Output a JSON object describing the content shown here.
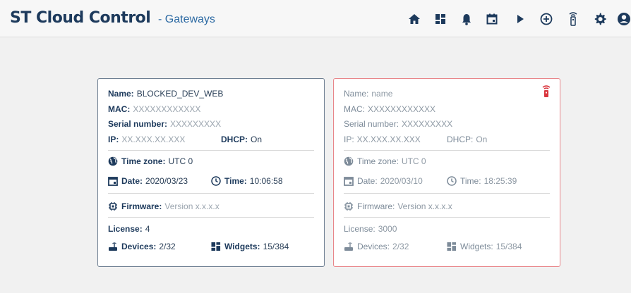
{
  "app": {
    "title": "ST Cloud Control",
    "section": "- Gateways"
  },
  "header_icons": [
    "home-icon",
    "dashboard-icon",
    "bell-icon",
    "calendar-icon",
    "play-icon",
    "add-circle-icon",
    "gateway-icon",
    "gear-icon",
    "account-icon"
  ],
  "labels": {
    "name": "Name:",
    "mac": "MAC:",
    "serial": "Serial number:",
    "ip": "IP:",
    "dhcp": "DHCP:",
    "timezone": "Time zone:",
    "date": "Date:",
    "time": "Time:",
    "firmware": "Firmware:",
    "license": "License:",
    "devices": "Devices:",
    "widgets": "Widgets:"
  },
  "cards": [
    {
      "name": "BLOCKED_DEV_WEB",
      "mac": "XXXXXXXXXXXX",
      "serial": "XXXXXXXXX",
      "ip": "XX.XXX.XX.XXX",
      "dhcp": "On",
      "timezone": "UTC 0",
      "date": "2020/03/23",
      "time": "10:06:58",
      "firmware": "Version x.x.x.x",
      "license": "4",
      "devices": "2/32",
      "widgets": "15/384",
      "status": "online"
    },
    {
      "name": "name",
      "mac": "XXXXXXXXXXXX",
      "serial": "XXXXXXXXX",
      "ip": "XX.XXX.XX.XXX",
      "dhcp": "On",
      "timezone": "UTC 0",
      "date": "2020/03/10",
      "time": "18:25:39",
      "firmware": "Version x.x.x.x",
      "license": "3000",
      "devices": "2/32",
      "widgets": "15/384",
      "status": "offline"
    }
  ],
  "colors": {
    "brand": "#1d3a5c",
    "section": "#2d6aa3",
    "offline_border": "#e8868a",
    "online_border": "#6e7f92",
    "alarm": "#d9353d"
  }
}
